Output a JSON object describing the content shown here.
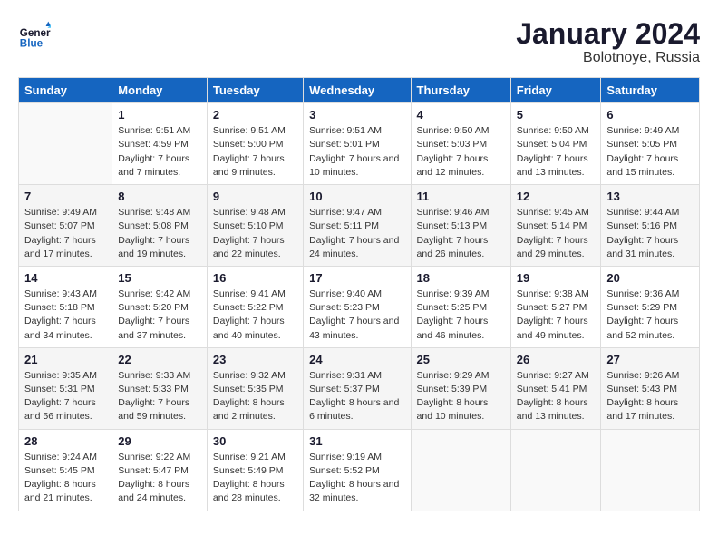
{
  "header": {
    "logo_line1": "General",
    "logo_line2": "Blue",
    "month": "January 2024",
    "location": "Bolotnoye, Russia"
  },
  "weekdays": [
    "Sunday",
    "Monday",
    "Tuesday",
    "Wednesday",
    "Thursday",
    "Friday",
    "Saturday"
  ],
  "weeks": [
    [
      {
        "day": "",
        "sunrise": "",
        "sunset": "",
        "daylight": ""
      },
      {
        "day": "1",
        "sunrise": "9:51 AM",
        "sunset": "4:59 PM",
        "daylight": "7 hours and 7 minutes."
      },
      {
        "day": "2",
        "sunrise": "9:51 AM",
        "sunset": "5:00 PM",
        "daylight": "7 hours and 9 minutes."
      },
      {
        "day": "3",
        "sunrise": "9:51 AM",
        "sunset": "5:01 PM",
        "daylight": "7 hours and 10 minutes."
      },
      {
        "day": "4",
        "sunrise": "9:50 AM",
        "sunset": "5:03 PM",
        "daylight": "7 hours and 12 minutes."
      },
      {
        "day": "5",
        "sunrise": "9:50 AM",
        "sunset": "5:04 PM",
        "daylight": "7 hours and 13 minutes."
      },
      {
        "day": "6",
        "sunrise": "9:49 AM",
        "sunset": "5:05 PM",
        "daylight": "7 hours and 15 minutes."
      }
    ],
    [
      {
        "day": "7",
        "sunrise": "9:49 AM",
        "sunset": "5:07 PM",
        "daylight": "7 hours and 17 minutes."
      },
      {
        "day": "8",
        "sunrise": "9:48 AM",
        "sunset": "5:08 PM",
        "daylight": "7 hours and 19 minutes."
      },
      {
        "day": "9",
        "sunrise": "9:48 AM",
        "sunset": "5:10 PM",
        "daylight": "7 hours and 22 minutes."
      },
      {
        "day": "10",
        "sunrise": "9:47 AM",
        "sunset": "5:11 PM",
        "daylight": "7 hours and 24 minutes."
      },
      {
        "day": "11",
        "sunrise": "9:46 AM",
        "sunset": "5:13 PM",
        "daylight": "7 hours and 26 minutes."
      },
      {
        "day": "12",
        "sunrise": "9:45 AM",
        "sunset": "5:14 PM",
        "daylight": "7 hours and 29 minutes."
      },
      {
        "day": "13",
        "sunrise": "9:44 AM",
        "sunset": "5:16 PM",
        "daylight": "7 hours and 31 minutes."
      }
    ],
    [
      {
        "day": "14",
        "sunrise": "9:43 AM",
        "sunset": "5:18 PM",
        "daylight": "7 hours and 34 minutes."
      },
      {
        "day": "15",
        "sunrise": "9:42 AM",
        "sunset": "5:20 PM",
        "daylight": "7 hours and 37 minutes."
      },
      {
        "day": "16",
        "sunrise": "9:41 AM",
        "sunset": "5:22 PM",
        "daylight": "7 hours and 40 minutes."
      },
      {
        "day": "17",
        "sunrise": "9:40 AM",
        "sunset": "5:23 PM",
        "daylight": "7 hours and 43 minutes."
      },
      {
        "day": "18",
        "sunrise": "9:39 AM",
        "sunset": "5:25 PM",
        "daylight": "7 hours and 46 minutes."
      },
      {
        "day": "19",
        "sunrise": "9:38 AM",
        "sunset": "5:27 PM",
        "daylight": "7 hours and 49 minutes."
      },
      {
        "day": "20",
        "sunrise": "9:36 AM",
        "sunset": "5:29 PM",
        "daylight": "7 hours and 52 minutes."
      }
    ],
    [
      {
        "day": "21",
        "sunrise": "9:35 AM",
        "sunset": "5:31 PM",
        "daylight": "7 hours and 56 minutes."
      },
      {
        "day": "22",
        "sunrise": "9:33 AM",
        "sunset": "5:33 PM",
        "daylight": "7 hours and 59 minutes."
      },
      {
        "day": "23",
        "sunrise": "9:32 AM",
        "sunset": "5:35 PM",
        "daylight": "8 hours and 2 minutes."
      },
      {
        "day": "24",
        "sunrise": "9:31 AM",
        "sunset": "5:37 PM",
        "daylight": "8 hours and 6 minutes."
      },
      {
        "day": "25",
        "sunrise": "9:29 AM",
        "sunset": "5:39 PM",
        "daylight": "8 hours and 10 minutes."
      },
      {
        "day": "26",
        "sunrise": "9:27 AM",
        "sunset": "5:41 PM",
        "daylight": "8 hours and 13 minutes."
      },
      {
        "day": "27",
        "sunrise": "9:26 AM",
        "sunset": "5:43 PM",
        "daylight": "8 hours and 17 minutes."
      }
    ],
    [
      {
        "day": "28",
        "sunrise": "9:24 AM",
        "sunset": "5:45 PM",
        "daylight": "8 hours and 21 minutes."
      },
      {
        "day": "29",
        "sunrise": "9:22 AM",
        "sunset": "5:47 PM",
        "daylight": "8 hours and 24 minutes."
      },
      {
        "day": "30",
        "sunrise": "9:21 AM",
        "sunset": "5:49 PM",
        "daylight": "8 hours and 28 minutes."
      },
      {
        "day": "31",
        "sunrise": "9:19 AM",
        "sunset": "5:52 PM",
        "daylight": "8 hours and 32 minutes."
      },
      {
        "day": "",
        "sunrise": "",
        "sunset": "",
        "daylight": ""
      },
      {
        "day": "",
        "sunrise": "",
        "sunset": "",
        "daylight": ""
      },
      {
        "day": "",
        "sunrise": "",
        "sunset": "",
        "daylight": ""
      }
    ]
  ]
}
